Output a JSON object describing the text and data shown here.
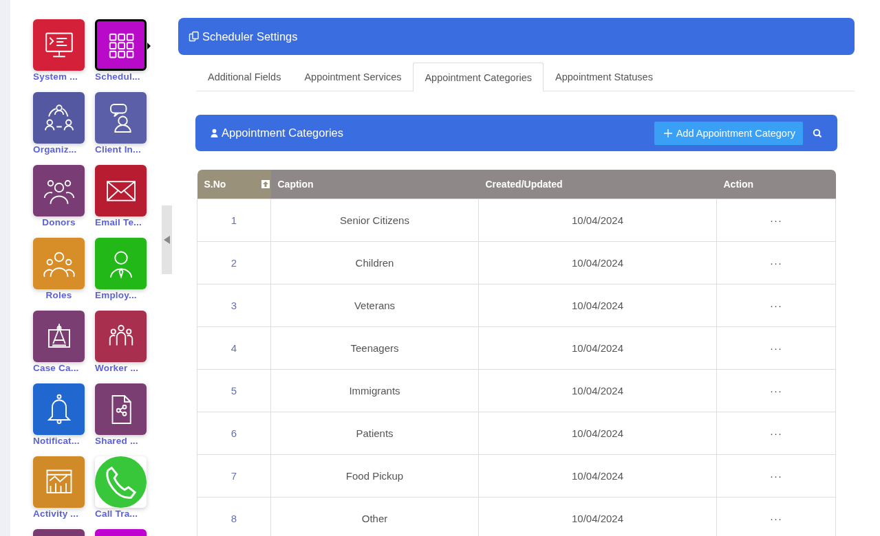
{
  "sidebar": {
    "tiles": [
      {
        "label": "System ...",
        "color": "#d42038",
        "selected": false
      },
      {
        "label": "Schedul...",
        "color": "#b80ac8",
        "selected": true
      },
      {
        "label": "Organiz...",
        "color": "#5358a0",
        "selected": false
      },
      {
        "label": "Client In...",
        "color": "#5a5fa8",
        "selected": false
      },
      {
        "label": "Donors",
        "color": "#7a3c74",
        "selected": false
      },
      {
        "label": "Email Te...",
        "color": "#b81c30",
        "selected": false
      },
      {
        "label": "Roles",
        "color": "#d88e28",
        "selected": false
      },
      {
        "label": "Employ...",
        "color": "#22b818",
        "selected": false
      },
      {
        "label": "Case Ca...",
        "color": "#7a3e72",
        "selected": false
      },
      {
        "label": "Worker ...",
        "color": "#a8304e",
        "selected": false
      },
      {
        "label": "Notificat...",
        "color": "#2068d0",
        "selected": false
      },
      {
        "label": "Shared ...",
        "color": "#7a3e72",
        "selected": false
      },
      {
        "label": "Activity ...",
        "color": "#d08a28",
        "selected": false
      },
      {
        "label": "Call Tra...",
        "color": "#ffffff",
        "selected": false
      },
      {
        "color": "#7a3a70",
        "selected": false
      },
      {
        "color": "#c000d0",
        "selected": false
      }
    ]
  },
  "page_header": {
    "title": "Scheduler Settings"
  },
  "tabs": [
    {
      "label": "Additional Fields",
      "selected": false
    },
    {
      "label": "Appointment Services",
      "selected": false
    },
    {
      "label": "Appointment Categories",
      "selected": true
    },
    {
      "label": "Appointment Statuses",
      "selected": false
    }
  ],
  "panel": {
    "title": "Appointment Categories",
    "add_button": "Add Appointment Category"
  },
  "table": {
    "columns": [
      "S.No",
      "Caption",
      "Created/Updated",
      "Action"
    ],
    "rows": [
      {
        "sno": "1",
        "caption": "Senior Citizens",
        "date": "10/04/2024",
        "action": "···"
      },
      {
        "sno": "2",
        "caption": "Children",
        "date": "10/04/2024",
        "action": "···"
      },
      {
        "sno": "3",
        "caption": "Veterans",
        "date": "10/04/2024",
        "action": "···"
      },
      {
        "sno": "4",
        "caption": "Teenagers",
        "date": "10/04/2024",
        "action": "···"
      },
      {
        "sno": "5",
        "caption": "Immigrants",
        "date": "10/04/2024",
        "action": "···"
      },
      {
        "sno": "6",
        "caption": "Patients",
        "date": "10/04/2024",
        "action": "···"
      },
      {
        "sno": "7",
        "caption": "Food Pickup",
        "date": "10/04/2024",
        "action": "···"
      },
      {
        "sno": "8",
        "caption": "Other",
        "date": "10/04/2024",
        "action": "···"
      }
    ]
  }
}
